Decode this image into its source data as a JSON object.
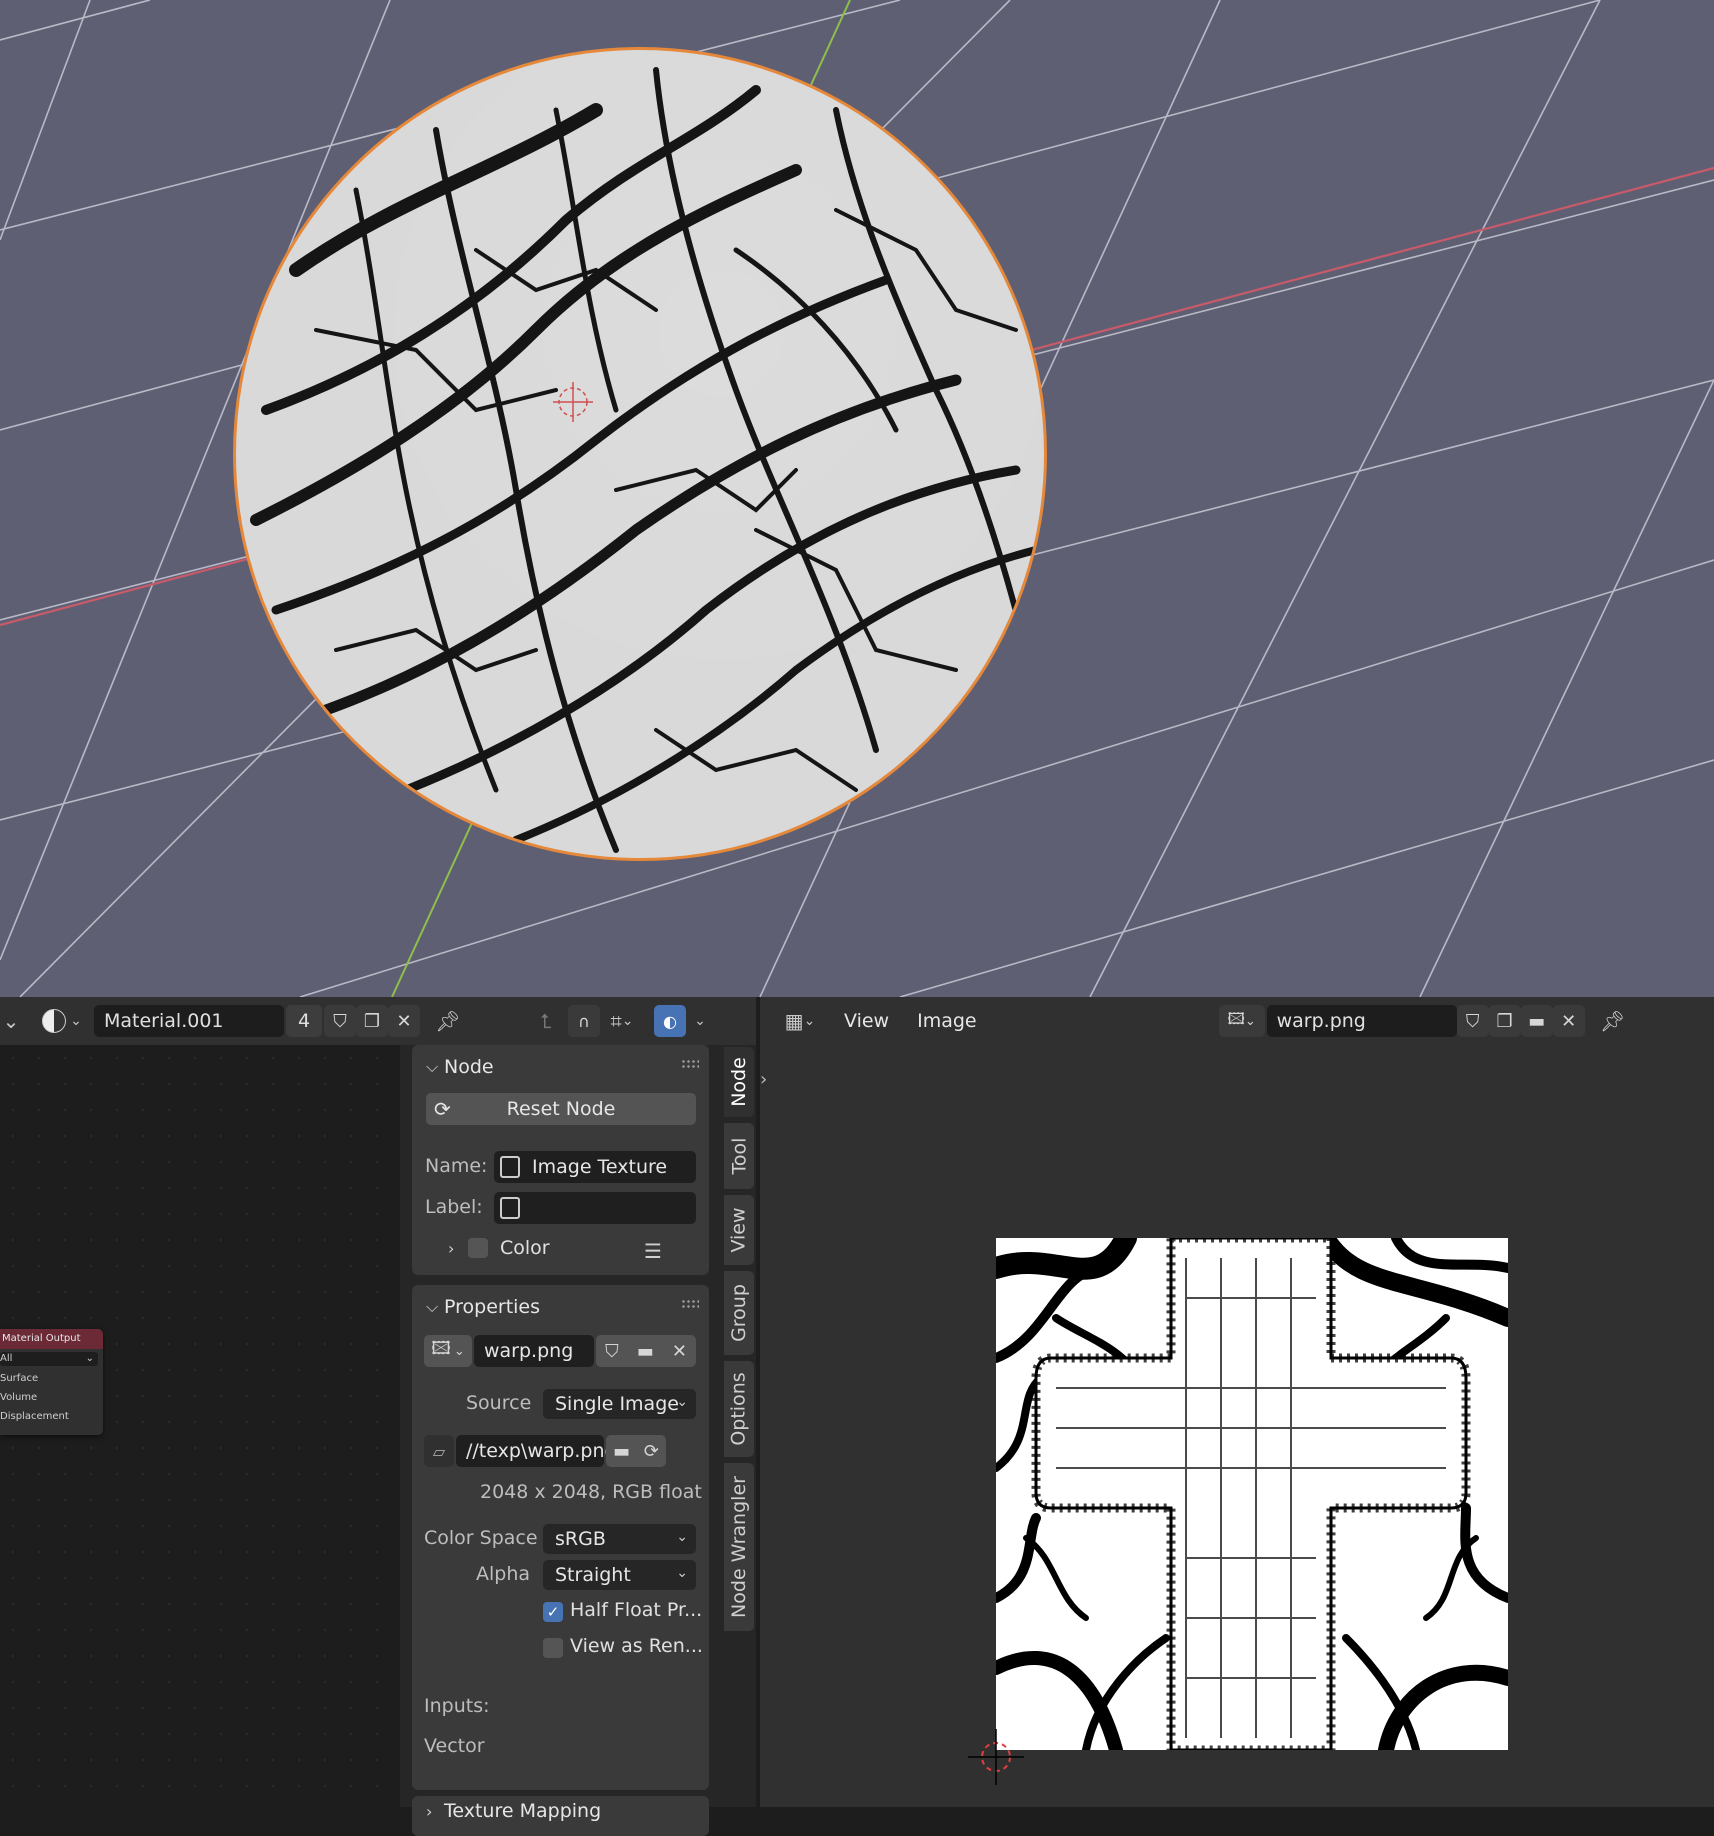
{
  "node_editor": {
    "material_name": "Material.001",
    "user_count": "4"
  },
  "mat_node": {
    "title": "Material Output",
    "target": "All",
    "sockets": [
      "Surface",
      "Volume",
      "Displacement"
    ]
  },
  "sidebar": {
    "node_panel": {
      "title": "Node",
      "reset_button": "Reset Node",
      "name_label": "Name:",
      "name_value": "Image Texture",
      "label_label": "Label:",
      "label_value": "",
      "color_label": "Color"
    },
    "properties_panel": {
      "title": "Properties",
      "image_name": "warp.png",
      "source_label": "Source",
      "source_value": "Single Image",
      "filepath": "//texp\\warp.png",
      "image_info": "2048 x 2048,  RGB float",
      "colorspace_label": "Color Space",
      "colorspace_value": "sRGB",
      "alpha_label": "Alpha",
      "alpha_value": "Straight",
      "half_float_label": "Half Float Pr...",
      "half_float_checked": true,
      "view_as_render_label": "View as Ren...",
      "view_as_render_checked": false,
      "inputs_label": "Inputs:",
      "vector_label": "Vector"
    },
    "texture_mapping_panel": {
      "title": "Texture Mapping"
    },
    "tabs": [
      "Node",
      "Tool",
      "View",
      "Group",
      "Options",
      "Node Wrangler"
    ]
  },
  "image_editor": {
    "menu": [
      "View",
      "Image"
    ],
    "image_name": "warp.png"
  },
  "colors": {
    "viewport_bg": "#5f5f74",
    "x_axis": "#c85a6a",
    "y_axis": "#8fbf4a",
    "selection_outline": "#e5883a",
    "accent_blue": "#4772b3",
    "node_output_header": "#6b2a36"
  }
}
